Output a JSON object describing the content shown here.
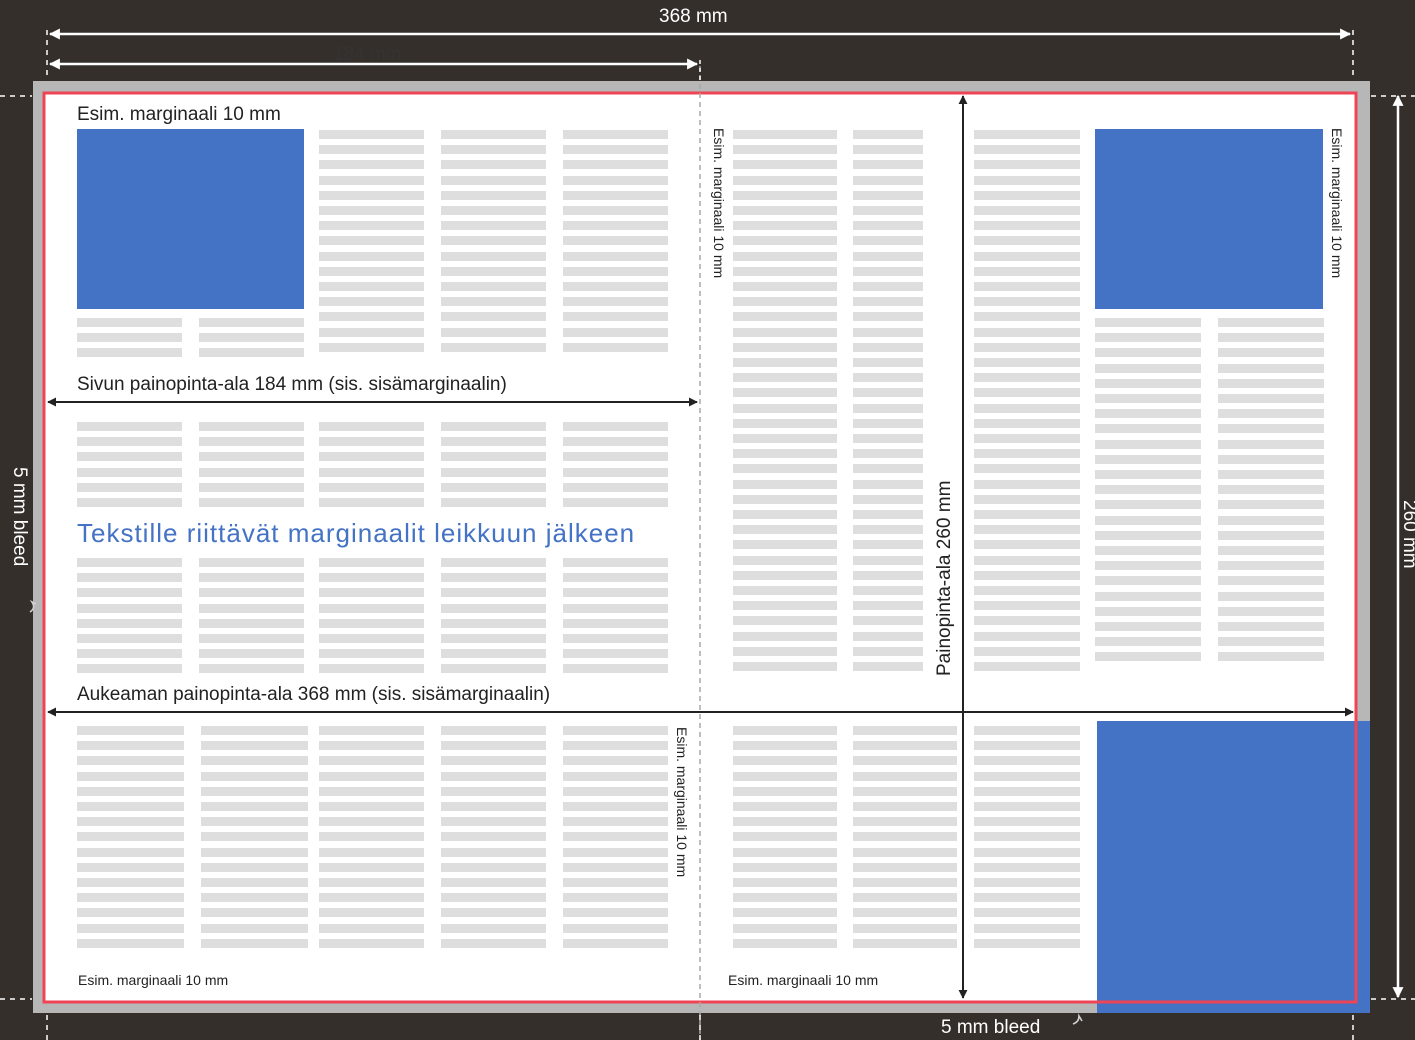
{
  "colors": {
    "background": "#352f2b",
    "bleed_area": "#b7b7b7",
    "page": "#ffffff",
    "trim_line": "#ee4455",
    "image_block": "#4472c4",
    "text_line": "#dedede",
    "arrow": "#222222",
    "dimension_arrow": "#ffffff",
    "headline": "#4472c4"
  },
  "dimensions": {
    "spread_width": "368 mm",
    "page_width": "184 mm",
    "height": "260 mm",
    "bleed_left": "5 mm bleed",
    "bleed_bottom": "5 mm bleed"
  },
  "labels": {
    "margin_top_left": "Esim. marginaali 10 mm",
    "margin_gutter_top": "Esim. marginaali 10 mm",
    "margin_right": "Esim. marginaali 10 mm",
    "margin_gutter_bottom": "Esim. marginaali 10 mm",
    "margin_bottom_left": "Esim. marginaali 10 mm",
    "margin_bottom_right": "Esim. marginaali 10 mm",
    "page_print_area": "Sivun painopinta-ala 184 mm (sis. sisämarginaalin)",
    "spread_print_area": "Aukeaman painopinta-ala 368 mm (sis. sisämarginaalin)",
    "print_area_height": "Painopinta-ala 260 mm",
    "headline": "Tekstille riittävät marginaalit leikkuun jälkeen"
  }
}
